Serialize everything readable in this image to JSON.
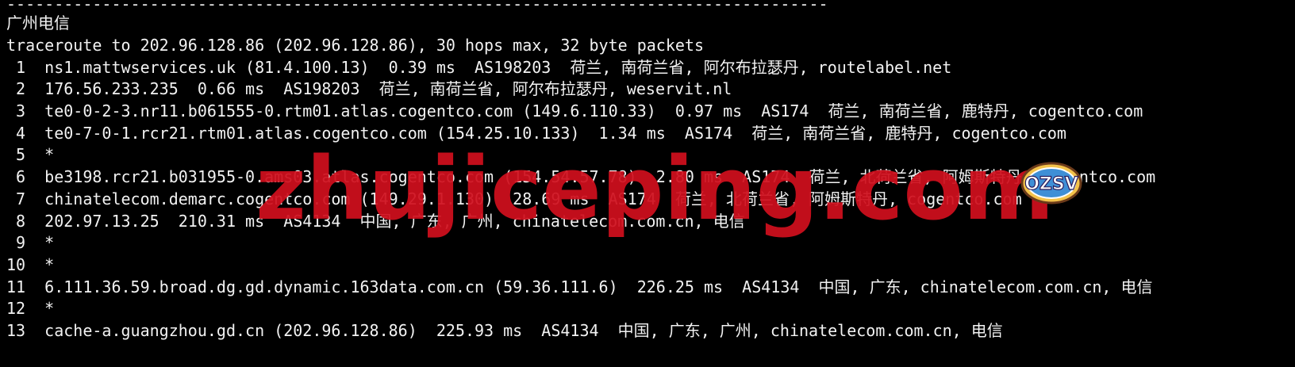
{
  "terminal": {
    "separator": "--------------------------------------------------------------------------------------",
    "section_title": "广州电信",
    "header": "traceroute to 202.96.128.86 (202.96.128.86), 30 hops max, 32 byte packets",
    "hops": [
      " 1  ns1.mattwservices.uk (81.4.100.13)  0.39 ms  AS198203  荷兰, 南荷兰省, 阿尔布拉瑟丹, routelabel.net",
      " 2  176.56.233.235  0.66 ms  AS198203  荷兰, 南荷兰省, 阿尔布拉瑟丹, weservit.nl",
      " 3  te0-0-2-3.nr11.b061555-0.rtm01.atlas.cogentco.com (149.6.110.33)  0.97 ms  AS174  荷兰, 南荷兰省, 鹿特丹, cogentco.com",
      " 4  te0-7-0-1.rcr21.rtm01.atlas.cogentco.com (154.25.10.133)  1.34 ms  AS174  荷兰, 南荷兰省, 鹿特丹, cogentco.com",
      " 5  *",
      " 6  be3198.rcr21.b031955-0.ams03.atlas.cogentco.com (154.54.57.78)  2.80 ms  AS174  荷兰, 北荷兰省, 阿姆斯特丹, cogentco.com",
      " 7  chinatelecom.demarc.cogentco.com (149.29.1.130)  28.69 ms  AS174  荷兰, 北荷兰省, 阿姆斯特丹, cogentco.com",
      " 8  202.97.13.25  210.31 ms  AS4134  中国, 广东, 广州, chinatelecom.com.cn, 电信",
      " 9  *",
      "10  *",
      "11  6.111.36.59.broad.dg.gd.dynamic.163data.com.cn (59.36.111.6)  226.25 ms  AS4134  中国, 广东, chinatelecom.com.cn, 电信",
      "12  *",
      "13  cache-a.guangzhou.gd.cn (202.96.128.86)  225.93 ms  AS4134  中国, 广东, 广州, chinatelecom.com.cn, 电信"
    ]
  },
  "watermark": {
    "text": "zhujiceping.com",
    "color": "#d0101e"
  },
  "logo": {
    "text": "OZSV",
    "icon": "ozsv-badge-icon"
  }
}
